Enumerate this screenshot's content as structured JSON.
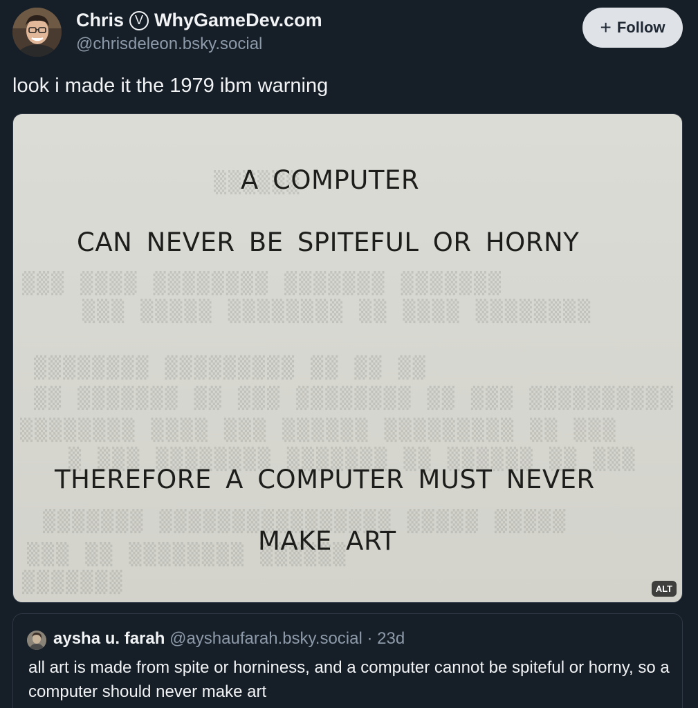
{
  "post": {
    "author": {
      "name_first": "Chris",
      "verified_glyph": "V",
      "name_rest": "WhyGameDev.com",
      "handle": "@chrisdeleon.bsky.social",
      "avatar_icon": "person-avatar"
    },
    "follow_button": {
      "icon": "plus-icon",
      "plus_glyph": "+",
      "label": "Follow"
    },
    "text": "look i made it the 1979 ibm warning",
    "image": {
      "warning_lines": [
        "A COMPUTER",
        "CAN NEVER BE SPITEFUL OR HORNY",
        "THEREFORE A COMPUTER MUST NEVER",
        "MAKE ART"
      ],
      "alt_badge": "ALT"
    },
    "quote": {
      "author_name": "aysha u. farah",
      "author_handle": "@ayshaufarah.bsky.social",
      "separator": " · ",
      "time": "23d",
      "text": "all art is made from spite or horniness, and a computer cannot be spiteful or horny, so a computer should never make art",
      "avatar_icon": "person-avatar"
    }
  },
  "colors": {
    "background": "#161e27",
    "text_primary": "#f1f3f5",
    "text_secondary": "#8d9aaa",
    "follow_button_bg": "#dfe3e8",
    "paper": "#d8d8d2"
  }
}
